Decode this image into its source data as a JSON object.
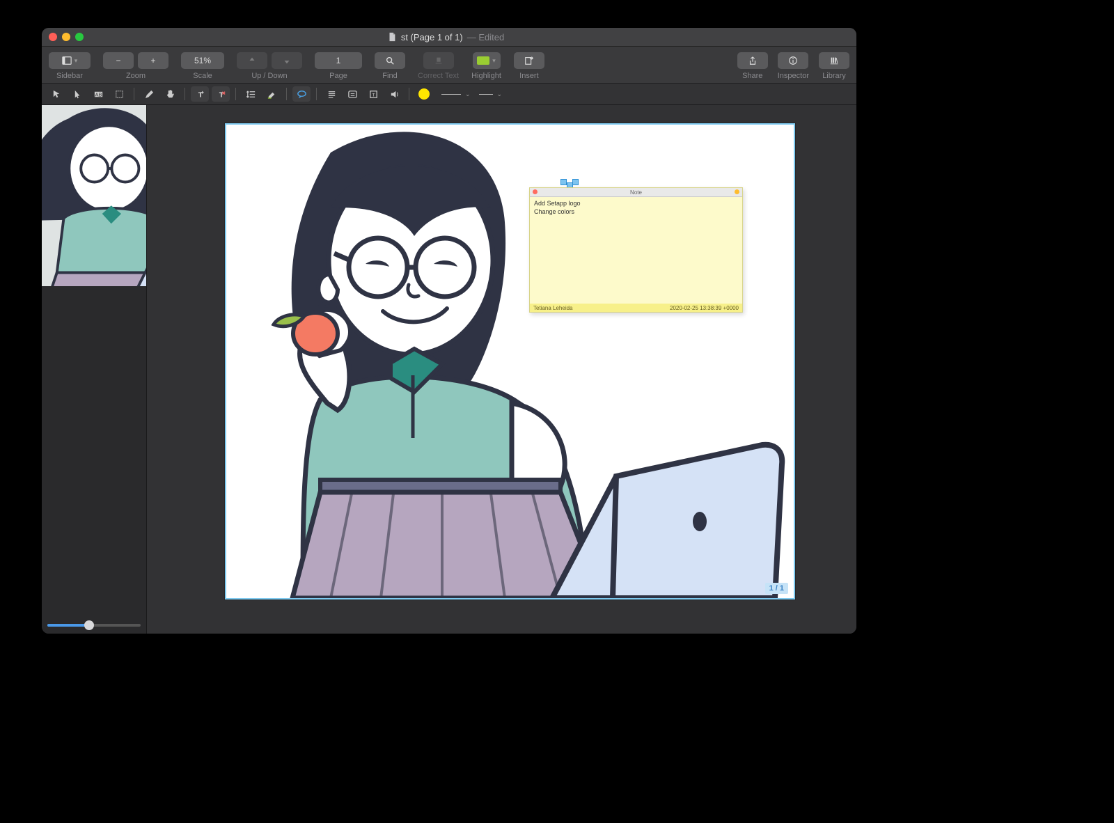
{
  "title": {
    "filename": "st (Page 1 of 1)",
    "edited": "— Edited"
  },
  "toolbar": {
    "sidebar": "Sidebar",
    "zoom": "Zoom",
    "zoom_minus": "−",
    "zoom_plus": "+",
    "scale": "Scale",
    "scale_value": "51%",
    "updown": "Up / Down",
    "page": "Page",
    "page_value": "1",
    "find": "Find",
    "correct": "Correct Text",
    "highlight": "Highlight",
    "insert": "Insert",
    "share": "Share",
    "inspector": "Inspector",
    "library": "Library"
  },
  "note": {
    "bar_title": "Note",
    "line1": "Add Setapp logo",
    "line2": "Change colors",
    "author": "Tetiana Leheida",
    "timestamp": "2020-02-25 13:38:39 +0000"
  },
  "page_indicator": "1 / 1",
  "tools2": [
    "edit-select",
    "select",
    "textbox-tool",
    "crop",
    "pencil",
    "hand",
    "text-add",
    "text-remove",
    "linespacing",
    "marker",
    "callout",
    "paragraph",
    "form",
    "link",
    "sound"
  ]
}
